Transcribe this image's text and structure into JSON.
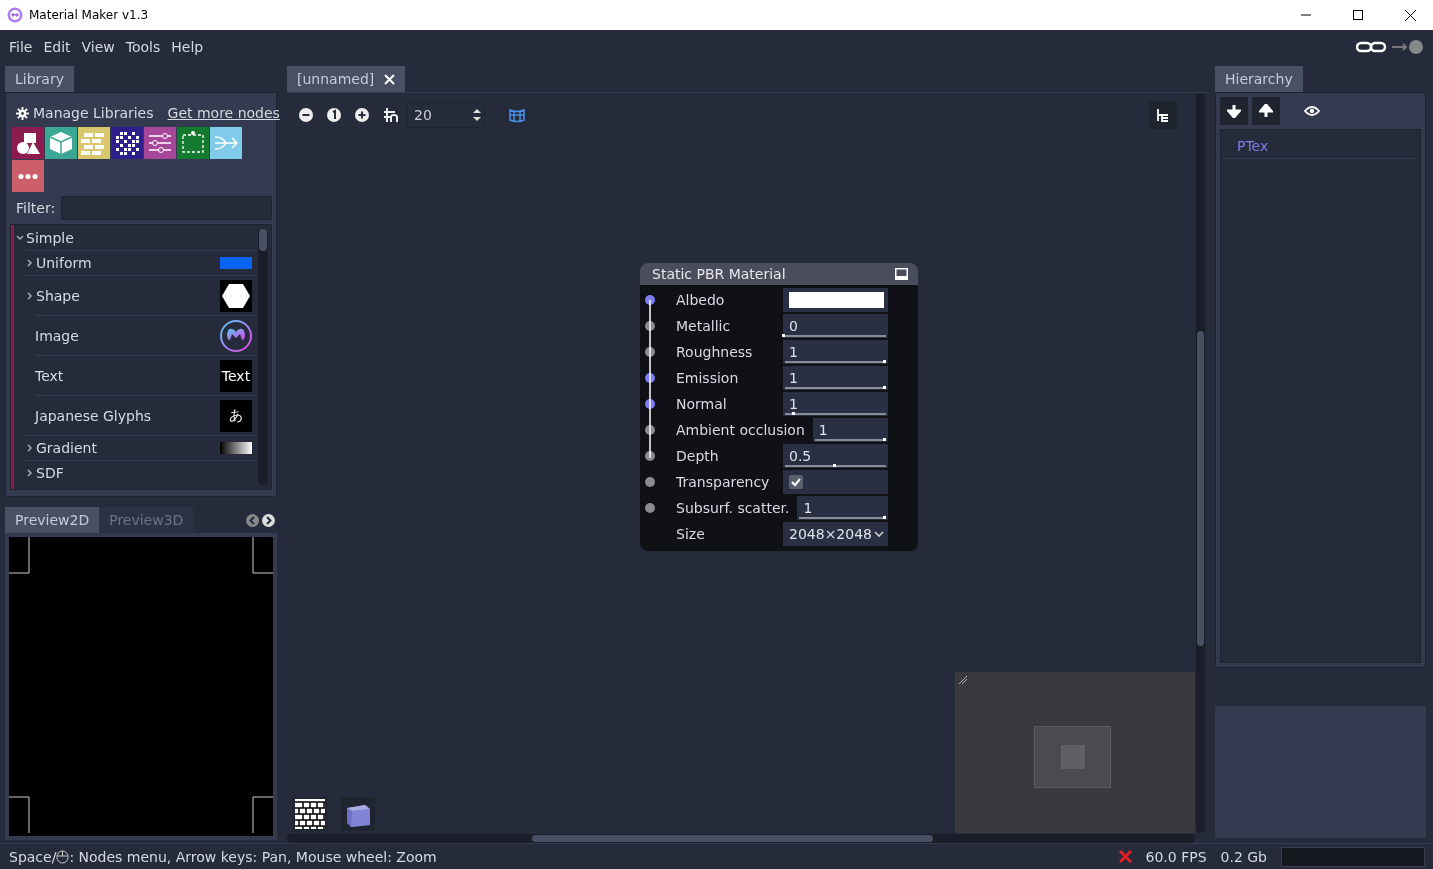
{
  "window": {
    "title": "Material Maker v1.3"
  },
  "menu": [
    "File",
    "Edit",
    "View",
    "Tools",
    "Help"
  ],
  "library": {
    "tab": {
      "label": "Library",
      "selected": true
    },
    "manage": "Manage Libraries",
    "more": "Get more nodes",
    "categories": [
      {
        "kind": "shapes",
        "color": "#8c1c4e"
      },
      {
        "kind": "cube",
        "color": "#3ba895"
      },
      {
        "kind": "bricks",
        "color": "#d8c76c"
      },
      {
        "kind": "noise",
        "color": "#2d208a"
      },
      {
        "kind": "sliders",
        "color": "#a6479a"
      },
      {
        "kind": "frame",
        "color": "#147a2f"
      },
      {
        "kind": "merge",
        "color": "#7fcbe9"
      },
      {
        "kind": "dots",
        "color": "#cd5f6a"
      }
    ],
    "filter": {
      "label": "Filter:"
    },
    "tree": [
      {
        "label": "Simple",
        "expanded": true,
        "children": [
          {
            "label": "Uniform",
            "kind": "folder",
            "thumb": {
              "kind": "swatch",
              "color": "#0a64f4"
            }
          },
          {
            "label": "Shape",
            "kind": "folder",
            "thumb": {
              "kind": "hexagon"
            }
          },
          {
            "label": "Image",
            "kind": "leaf",
            "thumb": {
              "kind": "logo"
            }
          },
          {
            "label": "Text",
            "kind": "leaf",
            "thumb": {
              "kind": "label",
              "text": "Text"
            }
          },
          {
            "label": "Japanese Glyphs",
            "kind": "leaf",
            "thumb": {
              "kind": "label",
              "text": "あ"
            }
          },
          {
            "label": "Gradient",
            "kind": "folder",
            "thumb": {
              "kind": "gradient"
            }
          },
          {
            "label": "SDF",
            "kind": "folder",
            "thumb": {
              "kind": "none"
            }
          }
        ]
      }
    ]
  },
  "preview": {
    "tabs": [
      {
        "label": "Preview2D",
        "selected": true
      },
      {
        "label": "Preview3D",
        "selected": false
      }
    ]
  },
  "graph": {
    "tab": {
      "label": "[unnamed]",
      "selected": true
    },
    "grid_size": "20",
    "node": {
      "title": "Static PBR Material",
      "params": [
        {
          "kind": "color",
          "label": "Albedo",
          "connected": true,
          "color": "#ffffff"
        },
        {
          "kind": "slider",
          "label": "Metallic",
          "connected": false,
          "value": "0",
          "level": 0
        },
        {
          "kind": "slider",
          "label": "Roughness",
          "connected": false,
          "value": "1",
          "level": 1
        },
        {
          "kind": "slider",
          "label": "Emission",
          "connected": true,
          "value": "1",
          "level": 1
        },
        {
          "kind": "slider",
          "label": "Normal",
          "connected": true,
          "value": "1",
          "level": 0.1
        },
        {
          "kind": "slider",
          "label": "Ambient occlusion",
          "connected": false,
          "value": "1",
          "level": 1
        },
        {
          "kind": "slider",
          "label": "Depth",
          "connected": false,
          "value": "0.5",
          "level": 0.5
        },
        {
          "kind": "checkbox",
          "label": "Transparency",
          "connected": false,
          "checked": true
        },
        {
          "kind": "slider",
          "label": "Subsurf. scatter.",
          "connected": false,
          "value": "1",
          "level": 1
        },
        {
          "kind": "select",
          "label": "Size",
          "value": "2048×2048"
        }
      ]
    }
  },
  "hierarchy": {
    "tab": {
      "label": "Hierarchy",
      "selected": true
    },
    "items": [
      "PTex"
    ]
  },
  "status": {
    "hint_prefix": "Space/",
    "hint": ": Nodes menu, Arrow keys: Pan, Mouse wheel: Zoom",
    "fps": "60.0 FPS",
    "memory": "0.2 Gb"
  }
}
